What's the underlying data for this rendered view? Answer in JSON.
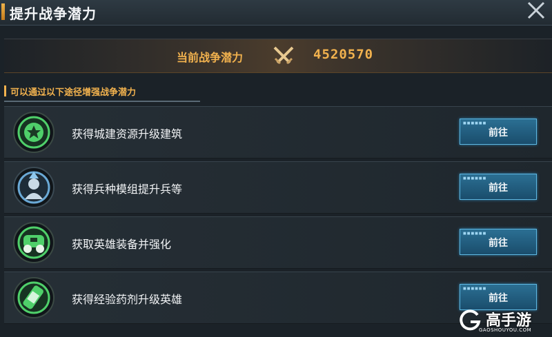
{
  "header": {
    "title": "提升战争潜力"
  },
  "banner": {
    "label": "当前战争潜力",
    "value": "4520570"
  },
  "section": {
    "title": "可以通过以下途径增强战争潜力"
  },
  "rows": [
    {
      "text": "获得城建资源升级建筑",
      "button": "前往",
      "icon": "city-star-icon"
    },
    {
      "text": "获得兵种模组提升兵等",
      "button": "前往",
      "icon": "soldier-upgrade-icon"
    },
    {
      "text": "获取英雄装备并强化",
      "button": "前往",
      "icon": "hero-equipment-icon"
    },
    {
      "text": "获得经验药剂升级英雄",
      "button": "前往",
      "icon": "exp-potion-icon"
    }
  ],
  "watermark": {
    "main": "高手游",
    "sub": "GAOSHOUYOU.COM"
  },
  "colors": {
    "accent": "#f2b24e",
    "button": "#2b6f93",
    "icon_green": "#4fd06a"
  }
}
